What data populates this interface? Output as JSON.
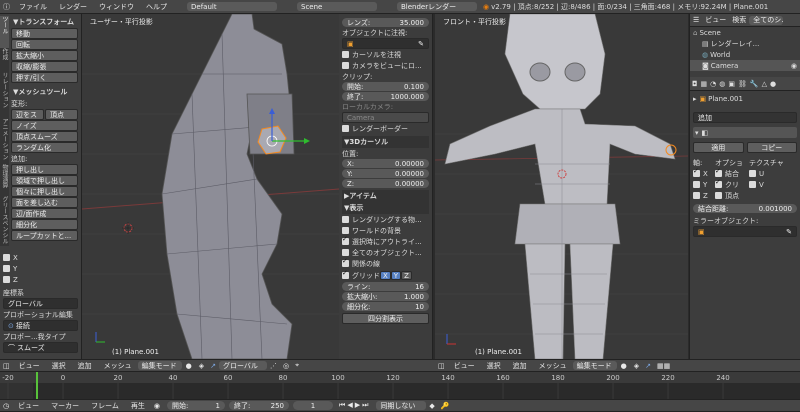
{
  "top_menu": {
    "items": [
      "ファイル",
      "レンダー",
      "ウィンドウ",
      "ヘルプ"
    ],
    "layout": "Default",
    "scene": "Scene",
    "engine": "Blenderレンダー",
    "stats": "v2.79 | 頂点:8/252 | 辺:8/486 | 面:0/234 | 三角面:468 | メモリ:92.24M | Plane.001"
  },
  "tool_shelf": {
    "header": "トランスフォーム",
    "transform_buttons": [
      "移動",
      "回転",
      "拡大縮小",
      "収縮/膨張",
      "押す/引く"
    ],
    "mesh_header": "メッシュツール",
    "deform_label": "変形:",
    "deform_buttons": [
      "辺をス",
      "頂点"
    ],
    "deform_more": [
      "ノイズ",
      "頂点スムーズ",
      "ランダム化"
    ],
    "add_label": "追加:",
    "add_buttons": [
      "押し出し",
      "領域で押し出し",
      "個々に押し出し",
      "面を差し込む",
      "辺/面作成",
      "細分化",
      "ループカットと..."
    ],
    "tabs": [
      "ツール",
      "作成",
      "リレーション",
      "アニメーション",
      "物理演算",
      "グリースペンシル"
    ]
  },
  "last_op": {
    "axes": [
      "X",
      "Y",
      "Z"
    ],
    "orientation_label": "座標系",
    "orientation": "グローバル",
    "prop_label": "プロポーショナル編集",
    "prop_value": "接続",
    "falloff_label": "プロポー...我タイプ",
    "falloff_value": "スムーズ"
  },
  "left_view": {
    "label": "ユーザー・平行投影",
    "object": "(1) Plane.001"
  },
  "props_panel": {
    "lens_label": "レンズ:",
    "lens_value": "35.000",
    "lock_label": "オブジェクトに注視:",
    "lock_cursor": "カーソルを注視",
    "lock_camera": "カメラをビューにロ...",
    "clip_label": "クリップ:",
    "clip_start_label": "開始:",
    "clip_start": "0.100",
    "clip_end_label": "終了:",
    "clip_end": "1000.000",
    "local_cam_label": "ローカルカメラ:",
    "local_cam": "Camera",
    "render_border": "レンダーボーダー",
    "cursor_header": "3Dカーソル",
    "location_label": "位置:",
    "cx_label": "X:",
    "cx": "0.00000",
    "cy_label": "Y:",
    "cy": "0.00000",
    "cz_label": "Z:",
    "cz": "0.00000",
    "item_header": "アイテム",
    "display_header": "表示",
    "only_render": "レンダリングする物...",
    "world_bg": "ワールドの背景",
    "outline": "選択時にアウトライ...",
    "all_edges": "全てのオブジェクト...",
    "rel_lines": "関係の線",
    "grid_label": "グリッド",
    "grid_axes": [
      "X",
      "Y",
      "Z"
    ],
    "lines_label": "ライン:",
    "lines": "16",
    "scale_label": "拡大縮小:",
    "scale": "1.000",
    "subdiv_label": "細分化:",
    "subdiv": "10",
    "quad_view": "四分割表示"
  },
  "right_view": {
    "label": "フロント・平行投影",
    "object": "(1) Plane.001"
  },
  "outliner": {
    "view": "ビュー",
    "search": "検索",
    "filter": "全てのシ...",
    "items": [
      "Scene",
      "レンダーレイ...",
      "World",
      "Camera"
    ]
  },
  "properties": {
    "path_object": "Plane.001",
    "add_label": "追加",
    "subsurf_apply": "適用",
    "subsurf_copy": "コピー",
    "axis_label": "軸:",
    "option_label": "オプショ",
    "texture_label": "テクスチャ",
    "mx": "X",
    "my": "Y",
    "mz": "Z",
    "merge": "結合",
    "clip": "クリ",
    "vertex": "頂点",
    "u": "U",
    "v": "V",
    "merge_dist_label": "結合距離:",
    "merge_dist": "0.001000",
    "mirror_obj": "ミラーオブジェクト:"
  },
  "view_header_left": {
    "items": [
      "ビュー",
      "選択",
      "追加",
      "メッシュ"
    ],
    "mode": "編集モード",
    "orientation": "グローバル"
  },
  "view_header_right": {
    "items": [
      "ビュー",
      "選択",
      "追加",
      "メッシュ"
    ],
    "mode": "編集モード"
  },
  "timeline": {
    "ticks": [
      "-20",
      "0",
      "20",
      "40",
      "60",
      "80",
      "100",
      "120",
      "140",
      "160",
      "180",
      "200",
      "220",
      "240"
    ],
    "current": "1"
  },
  "bottom_bar": {
    "items": [
      "ビュー",
      "マーカー",
      "フレーム",
      "再生"
    ],
    "start_label": "開始:",
    "start": "1",
    "end_label": "終了:",
    "end": "250",
    "current": "1",
    "sync": "同期しない"
  }
}
